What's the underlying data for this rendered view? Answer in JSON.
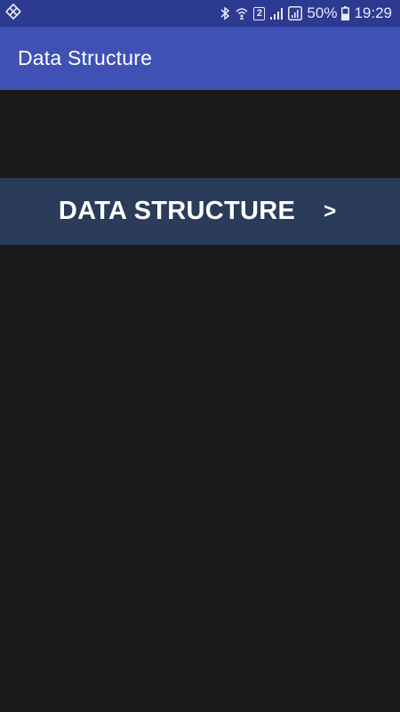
{
  "status_bar": {
    "battery_percent": "50%",
    "time": "19:29",
    "sim_slot": "2",
    "icons": [
      "move-icon",
      "bluetooth-icon",
      "wifi-calling-icon",
      "sim-2-badge",
      "signal-icon",
      "signal-sim-icon",
      "battery-icon"
    ]
  },
  "app_bar": {
    "title": "Data Structure"
  },
  "main": {
    "nav_item": {
      "label": "DATA STRUCTURE",
      "arrow": ">"
    }
  },
  "colors": {
    "status_bar": "#2d3a91",
    "app_bar": "#3f51b5",
    "background": "#1a1a1a",
    "nav_item": "#2b3c5a"
  }
}
